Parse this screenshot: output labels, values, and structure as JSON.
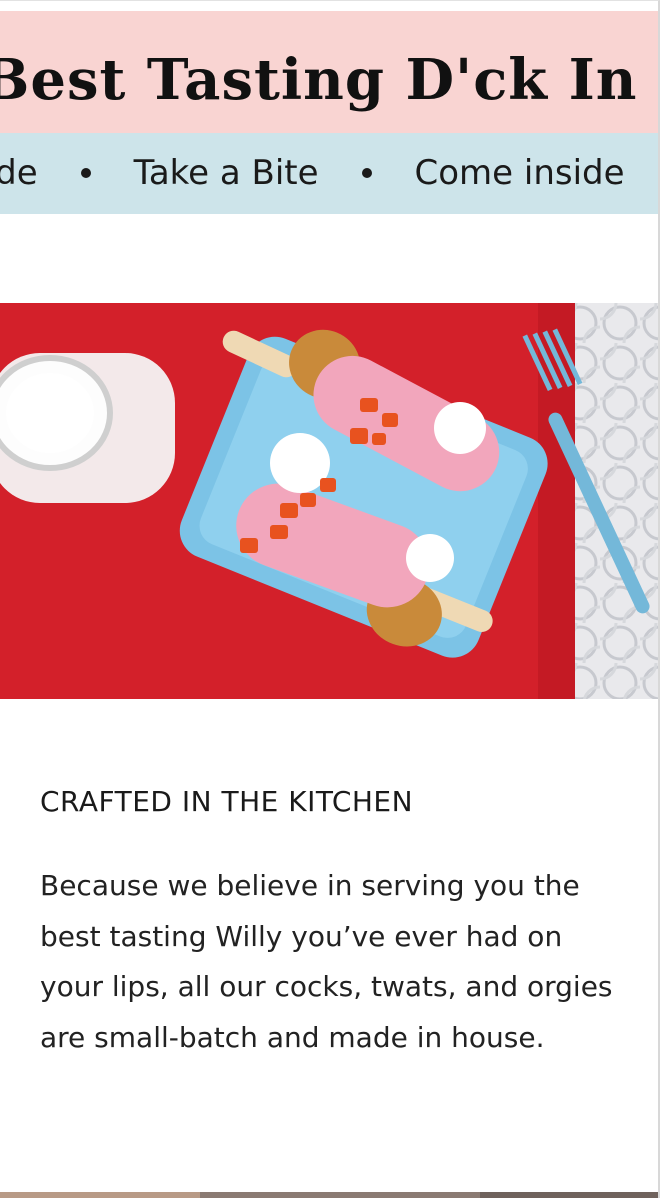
{
  "header": {
    "marquee_title": "Best Tasting D'ck In C",
    "marquee_items": [
      "side",
      "Take a Bite",
      "Come inside"
    ]
  },
  "hero_image": {
    "icon": "dessert-photo",
    "colors": {
      "tablecloth": "#d3202a",
      "plate": "#7cc3e6",
      "fork": "#74b8d9",
      "glaze": "#f2a6bc"
    }
  },
  "content": {
    "heading": "CRAFTED IN THE KITCHEN",
    "body": "Because we believe in serving you the best tasting Willy you’ve ever had on your lips, all our cocks, twats, and orgies are small-batch and made in house."
  }
}
